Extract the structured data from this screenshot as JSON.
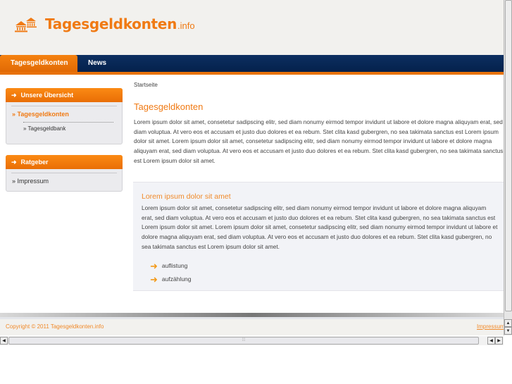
{
  "logo": {
    "name": "Tagesgeldkonten",
    "tld": ".info"
  },
  "nav": {
    "tabs": [
      {
        "label": "Tagesgeldkonten"
      },
      {
        "label": "News"
      }
    ]
  },
  "sidebar": {
    "box1": {
      "title": "Unsere Übersicht",
      "item": "» Tagesgeldkonten",
      "sub": "» Tagesgeldbank"
    },
    "box2": {
      "title": "Ratgeber",
      "item": "» Impressum"
    }
  },
  "breadcrumb": "Startseite",
  "main": {
    "title": "Tagesgeldkonten",
    "text": "Lorem ipsum dolor sit amet, consetetur sadipscing elitr, sed diam nonumy eirmod tempor invidunt ut labore et dolore magna aliquyam erat, sed diam voluptua. At vero eos et accusam et justo duo dolores et ea rebum. Stet clita kasd gubergren, no sea takimata sanctus est Lorem ipsum dolor sit amet. Lorem ipsum dolor sit amet, consetetur sadipscing elitr, sed diam nonumy eirmod tempor invidunt ut labore et dolore magna aliquyam erat, sed diam voluptua. At vero eos et accusam et justo duo dolores et ea rebum. Stet clita kasd gubergren, no sea takimata sanctus est Lorem ipsum dolor sit amet.",
    "panel": {
      "title": "Lorem ipsum dolor sit amet",
      "text": "Lorem ipsum dolor sit amet, consetetur sadipscing elitr, sed diam nonumy eirmod tempor invidunt ut labore et dolore magna aliquyam erat, sed diam voluptua. At vero eos et accusam et justo duo dolores et ea rebum. Stet clita kasd gubergren, no sea takimata sanctus est Lorem ipsum dolor sit amet. Lorem ipsum dolor sit amet, consetetur sadipscing elitr, sed diam nonumy eirmod tempor invidunt ut labore et dolore magna aliquyam erat, sed diam voluptua. At vero eos et accusam et justo duo dolores et ea rebum. Stet clita kasd gubergren, no sea takimata sanctus est Lorem ipsum dolor sit amet.",
      "list": [
        "auflistung",
        "aufzählung"
      ]
    }
  },
  "footer": {
    "copyright": "Copyright © 2011 Tagesgeldkonten.info",
    "link": "Impressum"
  },
  "colors": {
    "accent": "#f07a14",
    "nav": "#0d2f60"
  }
}
